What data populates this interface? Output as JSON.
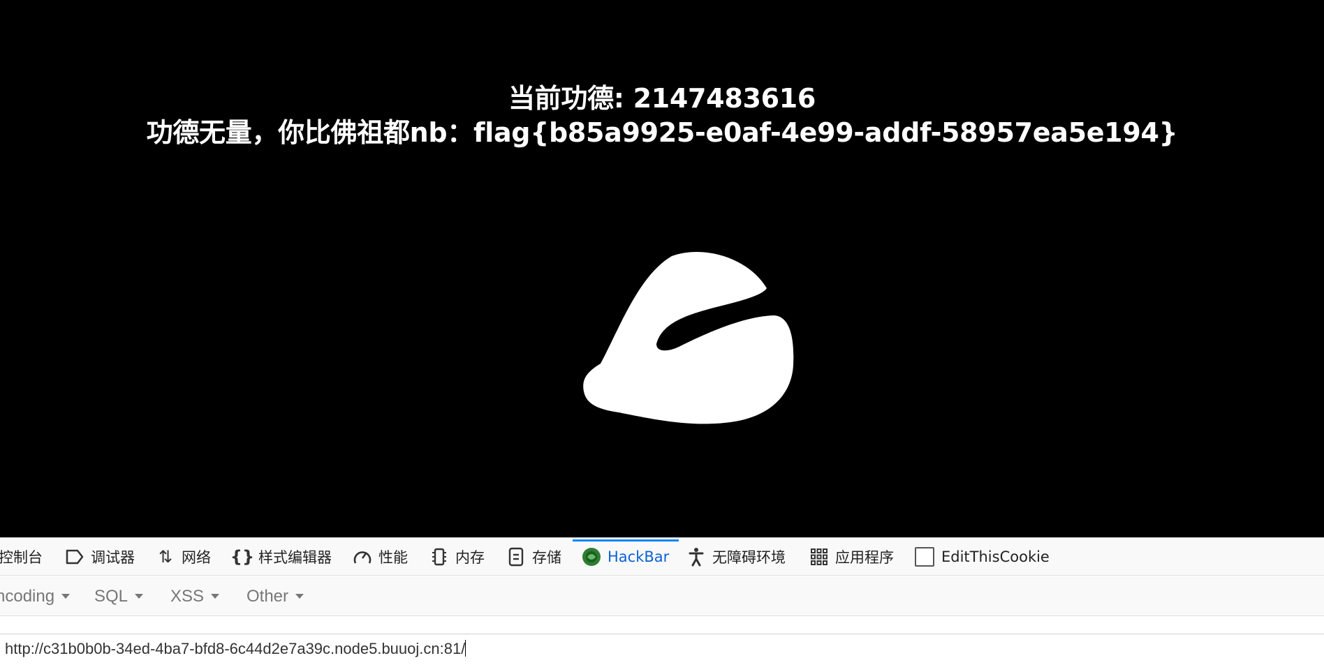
{
  "page": {
    "merit_label": "当前功德: 2147483616",
    "flag_message": "功德无量，你比佛祖都nb：flag{b85a9925-e0af-4e99-addf-58957ea5e194}",
    "background_color": "#000000",
    "foreground_color": "#ffffff"
  },
  "devtools": {
    "tabs": [
      {
        "label": "控制台",
        "icon": "console-icon"
      },
      {
        "label": "调试器",
        "icon": "debugger-icon"
      },
      {
        "label": "网络",
        "icon": "network-icon"
      },
      {
        "label": "样式编辑器",
        "icon": "style-editor-icon"
      },
      {
        "label": "性能",
        "icon": "performance-icon"
      },
      {
        "label": "内存",
        "icon": "memory-icon"
      },
      {
        "label": "存储",
        "icon": "storage-icon"
      },
      {
        "label": "HackBar",
        "icon": "hackbar-icon",
        "selected": true
      },
      {
        "label": "无障碍环境",
        "icon": "accessibility-icon"
      },
      {
        "label": "应用程序",
        "icon": "application-icon"
      },
      {
        "label": "EditThisCookie",
        "icon": "checkbox-icon"
      }
    ],
    "selected_color": "#0a84ff"
  },
  "hackbar": {
    "menus": [
      {
        "label": "ncoding"
      },
      {
        "label": "SQL"
      },
      {
        "label": "XSS"
      },
      {
        "label": "Other"
      }
    ],
    "url": "http://c31b0b0b-34ed-4ba7-bfd8-6c44d2e7a39c.node5.buuoj.cn:81/"
  }
}
